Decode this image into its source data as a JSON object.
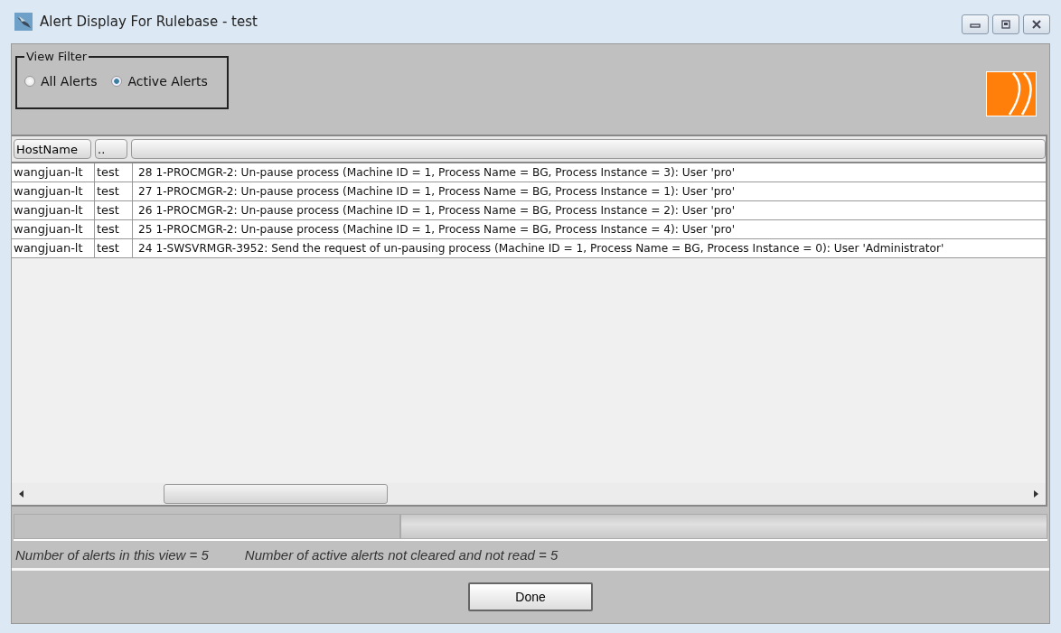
{
  "window": {
    "title": "Alert Display For Rulebase - test"
  },
  "view_filter": {
    "title": "View Filter",
    "options": [
      {
        "label": "All Alerts",
        "selected": false
      },
      {
        "label": "Active Alerts",
        "selected": true
      }
    ]
  },
  "table": {
    "columns": [
      "HostName",
      "..",
      ""
    ],
    "rows": [
      [
        "wangjuan-lt",
        "test",
        "28 1-PROCMGR-2: Un-pause process (Machine ID = 1, Process Name = BG, Process Instance = 3): User 'pro'"
      ],
      [
        "wangjuan-lt",
        "test",
        "27 1-PROCMGR-2: Un-pause process (Machine ID = 1, Process Name = BG, Process Instance = 1): User 'pro'"
      ],
      [
        "wangjuan-lt",
        "test",
        "26 1-PROCMGR-2: Un-pause process (Machine ID = 1, Process Name = BG, Process Instance = 2): User 'pro'"
      ],
      [
        "wangjuan-lt",
        "test",
        "25 1-PROCMGR-2: Un-pause process (Machine ID = 1, Process Name = BG, Process Instance = 4): User 'pro'"
      ],
      [
        "wangjuan-lt",
        "test",
        "24 1-SWSVRMGR-3952: Send the request of un-pausing process (Machine ID = 1, Process Name = BG, Process Instance = 0): User 'Administrator'"
      ]
    ]
  },
  "status": [
    "Number of alerts in this view  =  5",
    "Number of active alerts not cleared and not read  =  5"
  ],
  "buttons": [
    "Done"
  ]
}
